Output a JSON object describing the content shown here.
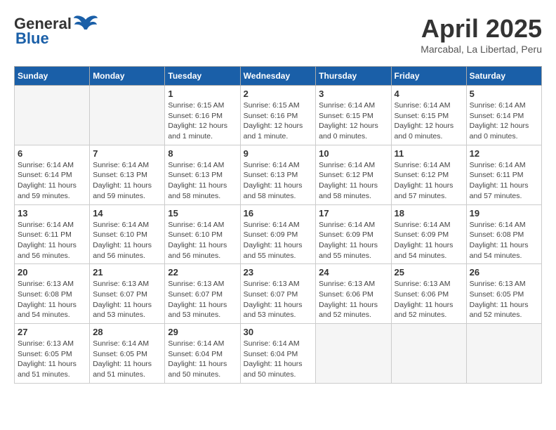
{
  "logo": {
    "part1": "General",
    "part2": "Blue"
  },
  "title": "April 2025",
  "subtitle": "Marcabal, La Libertad, Peru",
  "days_header": [
    "Sunday",
    "Monday",
    "Tuesday",
    "Wednesday",
    "Thursday",
    "Friday",
    "Saturday"
  ],
  "weeks": [
    [
      {
        "day": "",
        "info": ""
      },
      {
        "day": "",
        "info": ""
      },
      {
        "day": "1",
        "info": "Sunrise: 6:15 AM\nSunset: 6:16 PM\nDaylight: 12 hours and 1 minute."
      },
      {
        "day": "2",
        "info": "Sunrise: 6:15 AM\nSunset: 6:16 PM\nDaylight: 12 hours and 1 minute."
      },
      {
        "day": "3",
        "info": "Sunrise: 6:14 AM\nSunset: 6:15 PM\nDaylight: 12 hours and 0 minutes."
      },
      {
        "day": "4",
        "info": "Sunrise: 6:14 AM\nSunset: 6:15 PM\nDaylight: 12 hours and 0 minutes."
      },
      {
        "day": "5",
        "info": "Sunrise: 6:14 AM\nSunset: 6:14 PM\nDaylight: 12 hours and 0 minutes."
      }
    ],
    [
      {
        "day": "6",
        "info": "Sunrise: 6:14 AM\nSunset: 6:14 PM\nDaylight: 11 hours and 59 minutes."
      },
      {
        "day": "7",
        "info": "Sunrise: 6:14 AM\nSunset: 6:13 PM\nDaylight: 11 hours and 59 minutes."
      },
      {
        "day": "8",
        "info": "Sunrise: 6:14 AM\nSunset: 6:13 PM\nDaylight: 11 hours and 58 minutes."
      },
      {
        "day": "9",
        "info": "Sunrise: 6:14 AM\nSunset: 6:13 PM\nDaylight: 11 hours and 58 minutes."
      },
      {
        "day": "10",
        "info": "Sunrise: 6:14 AM\nSunset: 6:12 PM\nDaylight: 11 hours and 58 minutes."
      },
      {
        "day": "11",
        "info": "Sunrise: 6:14 AM\nSunset: 6:12 PM\nDaylight: 11 hours and 57 minutes."
      },
      {
        "day": "12",
        "info": "Sunrise: 6:14 AM\nSunset: 6:11 PM\nDaylight: 11 hours and 57 minutes."
      }
    ],
    [
      {
        "day": "13",
        "info": "Sunrise: 6:14 AM\nSunset: 6:11 PM\nDaylight: 11 hours and 56 minutes."
      },
      {
        "day": "14",
        "info": "Sunrise: 6:14 AM\nSunset: 6:10 PM\nDaylight: 11 hours and 56 minutes."
      },
      {
        "day": "15",
        "info": "Sunrise: 6:14 AM\nSunset: 6:10 PM\nDaylight: 11 hours and 56 minutes."
      },
      {
        "day": "16",
        "info": "Sunrise: 6:14 AM\nSunset: 6:09 PM\nDaylight: 11 hours and 55 minutes."
      },
      {
        "day": "17",
        "info": "Sunrise: 6:14 AM\nSunset: 6:09 PM\nDaylight: 11 hours and 55 minutes."
      },
      {
        "day": "18",
        "info": "Sunrise: 6:14 AM\nSunset: 6:09 PM\nDaylight: 11 hours and 54 minutes."
      },
      {
        "day": "19",
        "info": "Sunrise: 6:14 AM\nSunset: 6:08 PM\nDaylight: 11 hours and 54 minutes."
      }
    ],
    [
      {
        "day": "20",
        "info": "Sunrise: 6:13 AM\nSunset: 6:08 PM\nDaylight: 11 hours and 54 minutes."
      },
      {
        "day": "21",
        "info": "Sunrise: 6:13 AM\nSunset: 6:07 PM\nDaylight: 11 hours and 53 minutes."
      },
      {
        "day": "22",
        "info": "Sunrise: 6:13 AM\nSunset: 6:07 PM\nDaylight: 11 hours and 53 minutes."
      },
      {
        "day": "23",
        "info": "Sunrise: 6:13 AM\nSunset: 6:07 PM\nDaylight: 11 hours and 53 minutes."
      },
      {
        "day": "24",
        "info": "Sunrise: 6:13 AM\nSunset: 6:06 PM\nDaylight: 11 hours and 52 minutes."
      },
      {
        "day": "25",
        "info": "Sunrise: 6:13 AM\nSunset: 6:06 PM\nDaylight: 11 hours and 52 minutes."
      },
      {
        "day": "26",
        "info": "Sunrise: 6:13 AM\nSunset: 6:05 PM\nDaylight: 11 hours and 52 minutes."
      }
    ],
    [
      {
        "day": "27",
        "info": "Sunrise: 6:13 AM\nSunset: 6:05 PM\nDaylight: 11 hours and 51 minutes."
      },
      {
        "day": "28",
        "info": "Sunrise: 6:14 AM\nSunset: 6:05 PM\nDaylight: 11 hours and 51 minutes."
      },
      {
        "day": "29",
        "info": "Sunrise: 6:14 AM\nSunset: 6:04 PM\nDaylight: 11 hours and 50 minutes."
      },
      {
        "day": "30",
        "info": "Sunrise: 6:14 AM\nSunset: 6:04 PM\nDaylight: 11 hours and 50 minutes."
      },
      {
        "day": "",
        "info": ""
      },
      {
        "day": "",
        "info": ""
      },
      {
        "day": "",
        "info": ""
      }
    ]
  ]
}
